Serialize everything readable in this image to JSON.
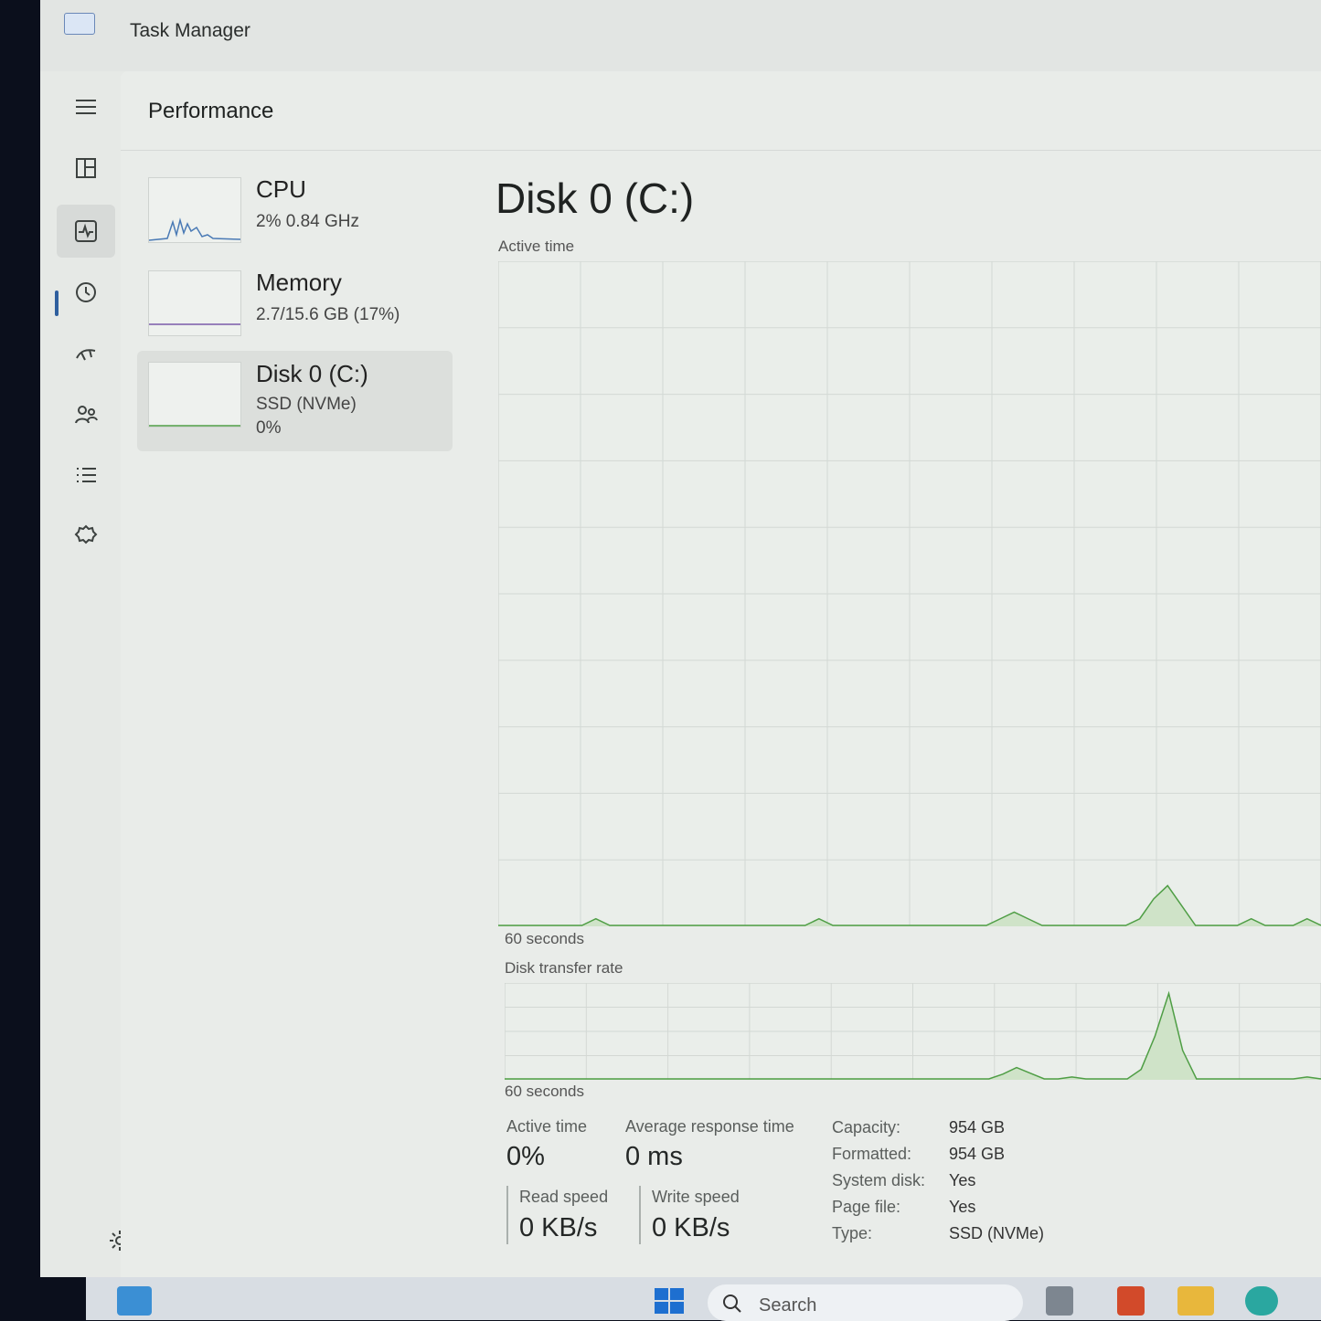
{
  "window": {
    "title": "Task Manager"
  },
  "nav": {
    "items": [
      "menu-icon",
      "processes-icon",
      "performance-icon",
      "app-history-icon",
      "startup-apps-icon",
      "users-icon",
      "details-icon",
      "services-icon",
      "settings-icon"
    ]
  },
  "performance": {
    "title": "Performance"
  },
  "devices": [
    {
      "name": "CPU",
      "line1": "2%  0.84 GHz",
      "line2": ""
    },
    {
      "name": "Memory",
      "line1": "2.7/15.6 GB (17%)",
      "line2": ""
    },
    {
      "name": "Disk 0 (C:)",
      "line1": "SSD (NVMe)",
      "line2": "0%"
    }
  ],
  "disk": {
    "title": "Disk 0 (C:)",
    "active_time_label": "Active time",
    "active_axis": "60 seconds",
    "transfer_label": "Disk transfer rate",
    "transfer_axis": "60 seconds",
    "stats": {
      "active_time_label": "Active time",
      "active_time": "0%",
      "avg_resp_label": "Average response time",
      "avg_resp": "0 ms",
      "read_label": "Read speed",
      "read": "0 KB/s",
      "write_label": "Write speed",
      "write": "0 KB/s"
    },
    "props": [
      {
        "k": "Capacity:",
        "v": "954 GB"
      },
      {
        "k": "Formatted:",
        "v": "954 GB"
      },
      {
        "k": "System disk:",
        "v": "Yes"
      },
      {
        "k": "Page file:",
        "v": "Yes"
      },
      {
        "k": "Type:",
        "v": "SSD (NVMe)"
      }
    ],
    "active_series": [
      0,
      0,
      0,
      0,
      0,
      0,
      0,
      1,
      0,
      0,
      0,
      0,
      0,
      0,
      0,
      0,
      0,
      0,
      0,
      0,
      0,
      0,
      0,
      1,
      0,
      0,
      0,
      0,
      0,
      0,
      0,
      0,
      0,
      0,
      0,
      0,
      1,
      2,
      1,
      0,
      0,
      0,
      0,
      0,
      0,
      0,
      1,
      4,
      6,
      3,
      0,
      0,
      0,
      0,
      1,
      0,
      0,
      0,
      1,
      0
    ],
    "transfer_series": [
      0,
      0,
      0,
      0,
      0,
      0,
      0,
      0,
      0,
      0,
      0,
      0,
      0,
      0,
      0,
      0,
      0,
      0,
      0,
      0,
      0,
      0,
      0,
      0,
      0,
      0,
      0,
      0,
      0,
      0,
      0,
      0,
      0,
      0,
      0,
      0,
      5,
      12,
      6,
      0,
      0,
      2,
      0,
      0,
      0,
      0,
      10,
      45,
      90,
      30,
      0,
      0,
      0,
      0,
      0,
      0,
      0,
      0,
      2,
      0
    ]
  },
  "taskbar": {
    "search_placeholder": "Search"
  },
  "colors": {
    "accent": "#2f5f9e",
    "disk_line": "#4f9e45",
    "disk_fill": "#cfe3c8"
  }
}
